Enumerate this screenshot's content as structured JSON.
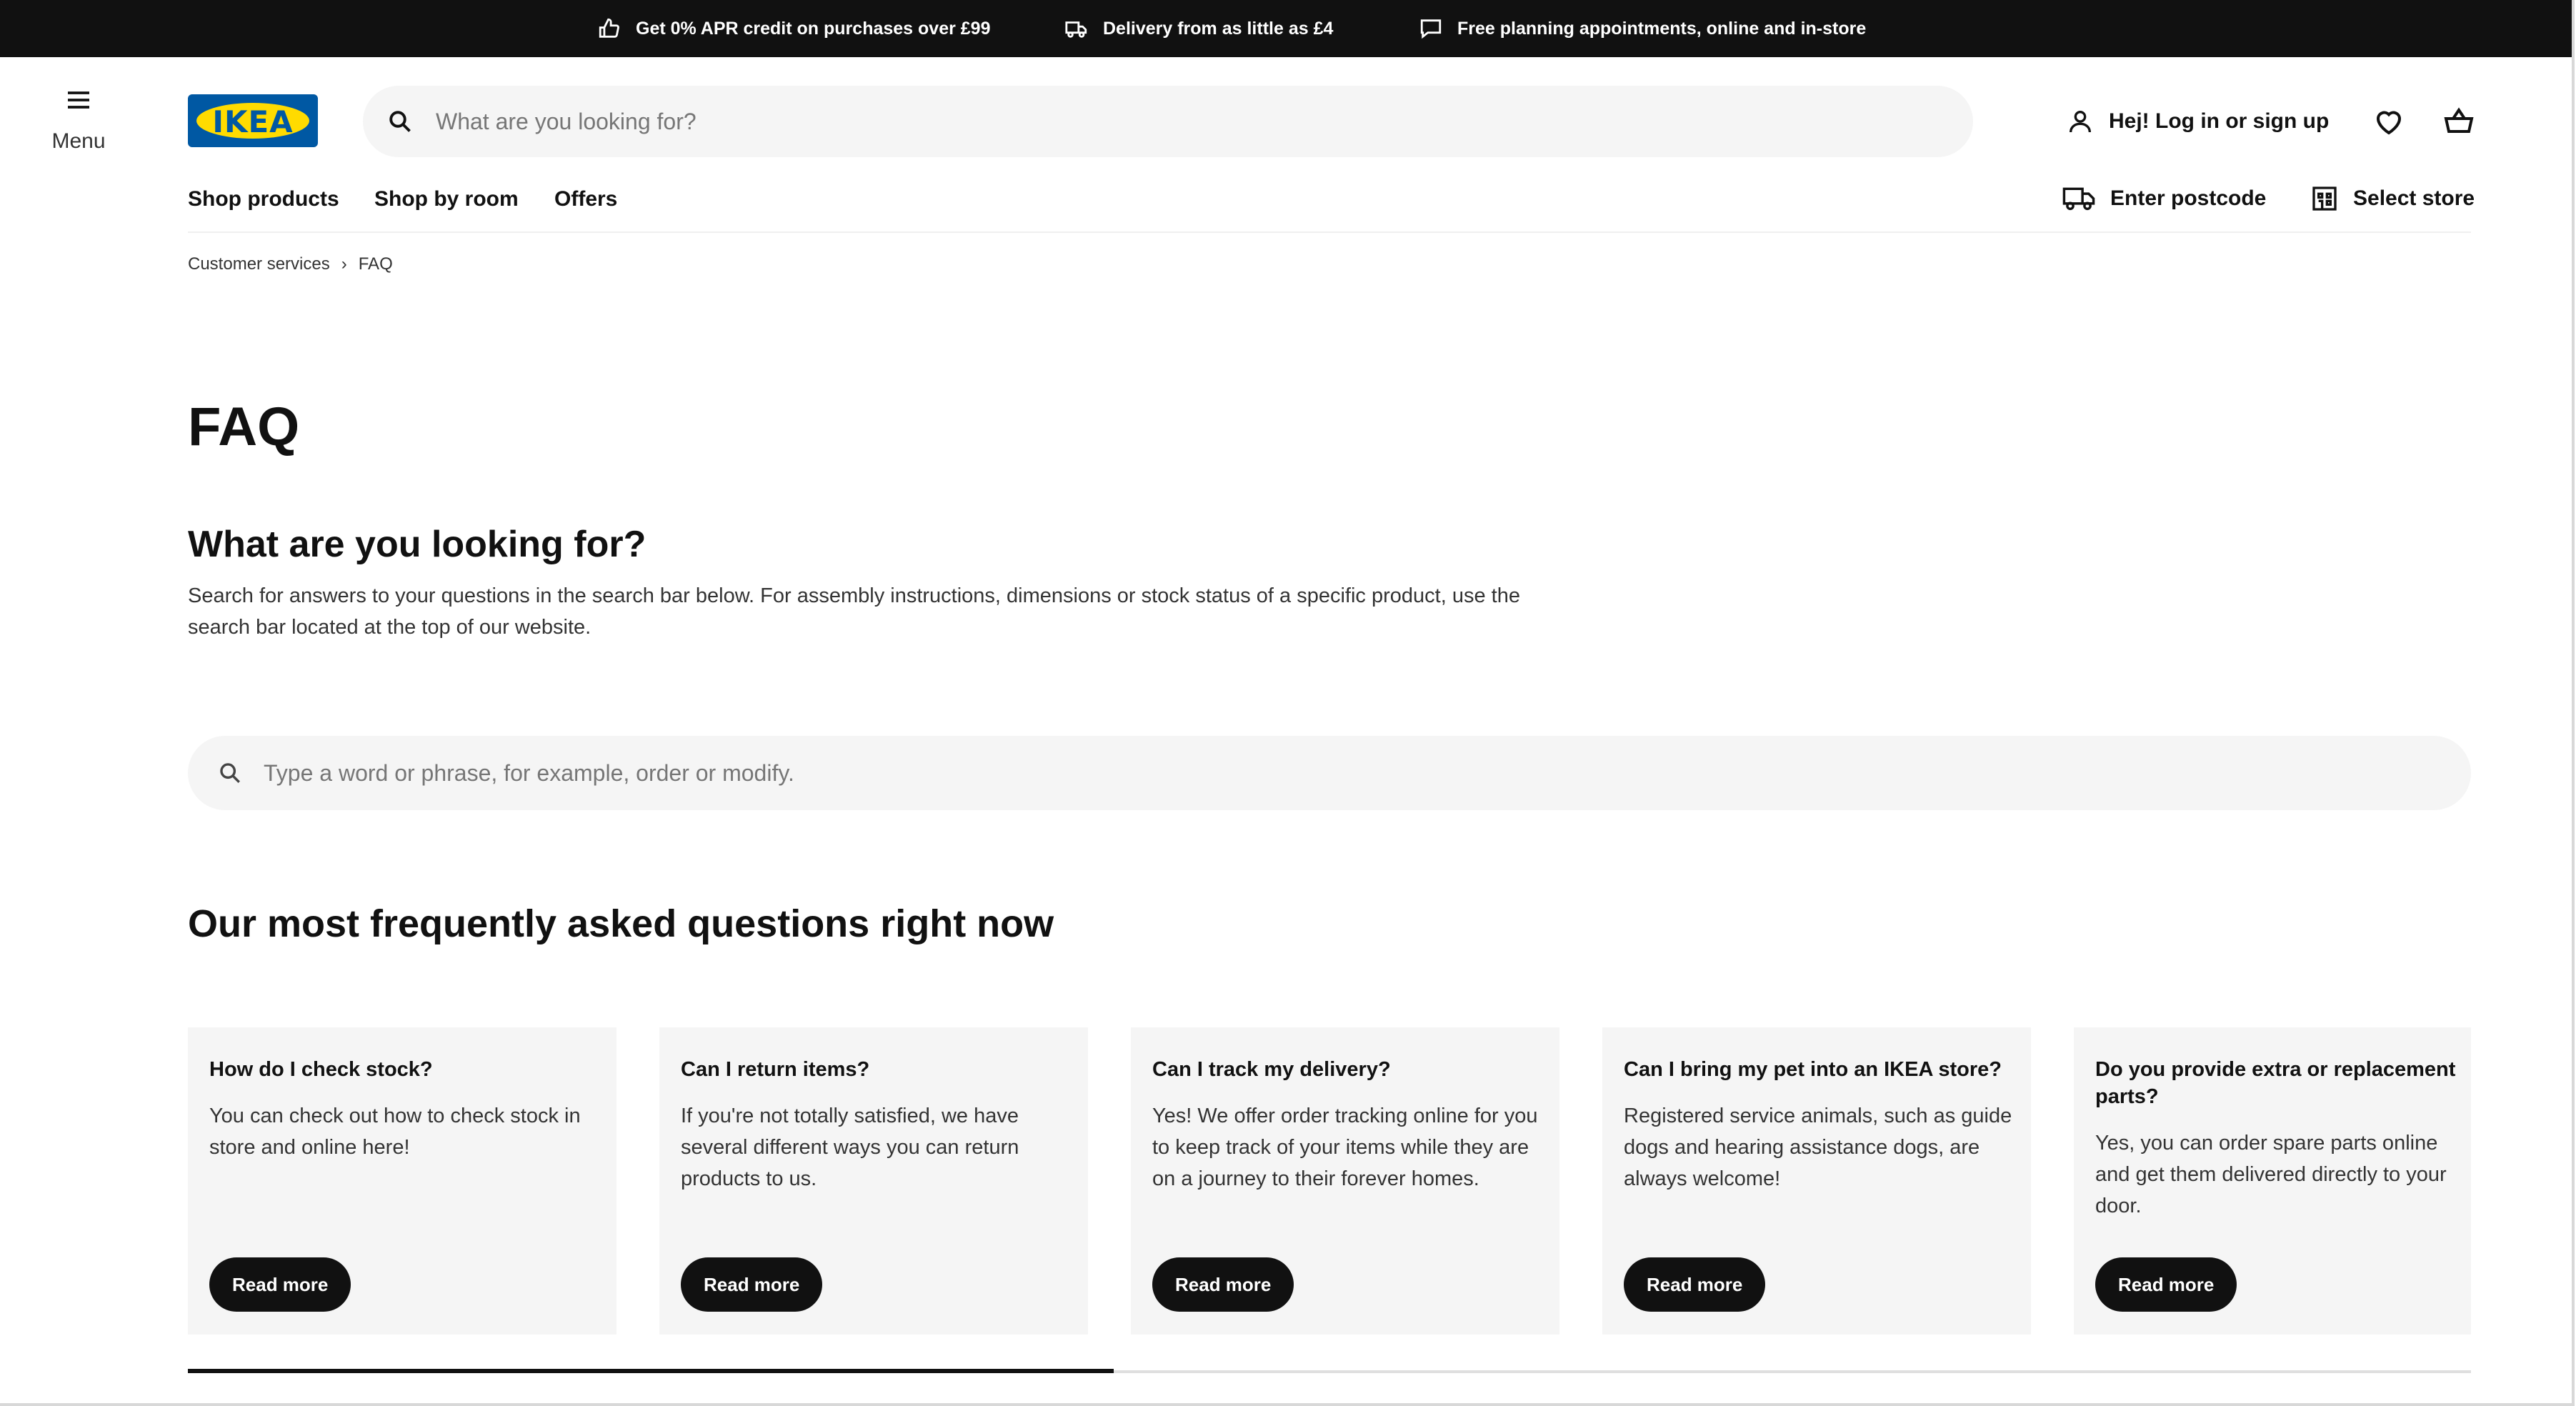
{
  "promo": {
    "items": [
      {
        "icon": "thumbs-up-icon",
        "text": "Get 0% APR credit on purchases over £99"
      },
      {
        "icon": "delivery-truck-icon",
        "text": "Delivery from as little as £4"
      },
      {
        "icon": "chat-bubble-icon",
        "text": "Free planning appointments, online and in-store"
      }
    ]
  },
  "header": {
    "menu_label": "Menu",
    "logo_text": "IKEA",
    "search_placeholder": "What are you looking for?",
    "account_label": "Hej! Log in or sign up"
  },
  "nav": {
    "links": [
      "Shop products",
      "Shop by room",
      "Offers"
    ],
    "postcode_label": "Enter postcode",
    "store_label": "Select store"
  },
  "breadcrumb": [
    "Customer services",
    "FAQ"
  ],
  "page_title": "FAQ",
  "lookup": {
    "heading": "What are you looking for?",
    "intro": "Search for answers to your questions in the search bar below. For assembly instructions, dimensions or stock status of a specific product, use the search bar located at the top of our website.",
    "search_placeholder": "Type a word or phrase, for example, order or modify."
  },
  "faq": {
    "heading": "Our most frequently asked questions right now",
    "button_label": "Read more",
    "cards": [
      {
        "question": "How do I check stock?",
        "answer": "You can check out how to check stock in store and online here!"
      },
      {
        "question": "Can I return items?",
        "answer": "If you're not totally satisfied, we have several different ways you can return products to us."
      },
      {
        "question": "Can I track my delivery?",
        "answer": "Yes! We offer order tracking online for you to keep track of your items while they are on a journey to their forever homes."
      },
      {
        "question": "Can I bring my pet into an IKEA store?",
        "answer": "Registered service animals, such as guide dogs and hearing assistance dogs, are always welcome!"
      },
      {
        "question": "Do you provide extra or replacement parts?",
        "answer": "Yes, you can order spare parts online and get them delivered directly to your door."
      }
    ]
  },
  "colors": {
    "brand_blue": "#0058a3",
    "brand_yellow": "#ffdb00",
    "dark": "#111111",
    "card_bg": "#f5f5f5"
  }
}
